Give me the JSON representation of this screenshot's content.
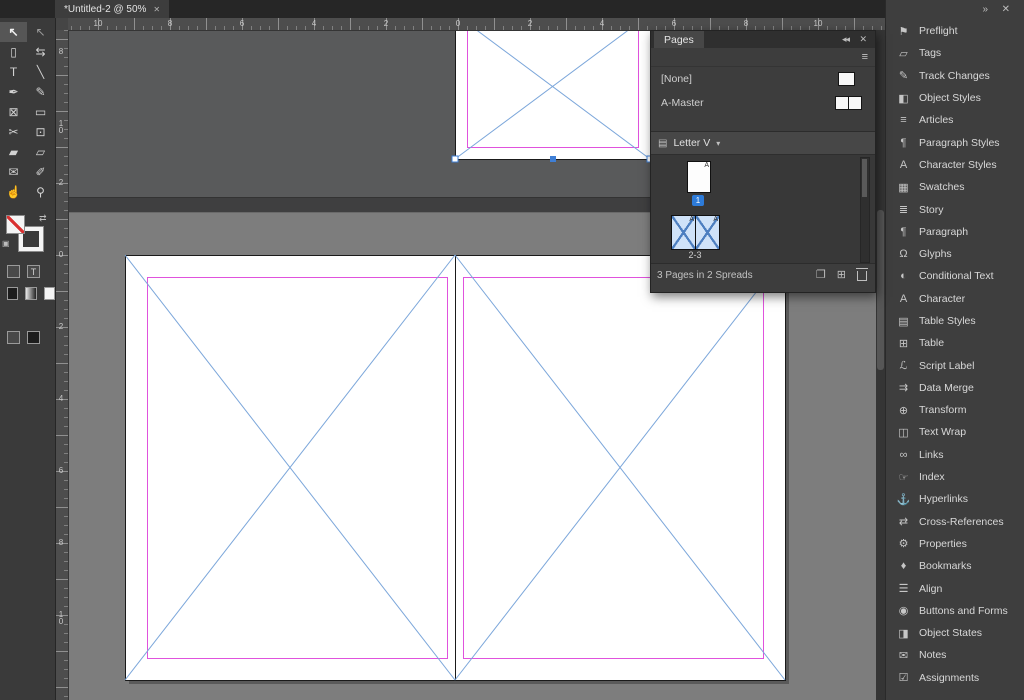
{
  "window": {
    "tab_title": "*Untitled-2 @ 50%",
    "tab_close_icon": "✕"
  },
  "toolbar": {
    "tools": [
      {
        "name": "selection-tool",
        "glyph": "↖",
        "style": "filled",
        "active": true
      },
      {
        "name": "direct-selection-tool",
        "glyph": "↖",
        "style": "hollow"
      },
      {
        "name": "page-tool",
        "glyph": "▯"
      },
      {
        "name": "gap-tool",
        "glyph": "⇆"
      },
      {
        "name": "type-tool",
        "glyph": "T"
      },
      {
        "name": "line-tool",
        "glyph": "╲"
      },
      {
        "name": "pen-tool",
        "glyph": "✒"
      },
      {
        "name": "pencil-tool",
        "glyph": "✎"
      },
      {
        "name": "rectangle-frame-tool",
        "glyph": "⊠"
      },
      {
        "name": "rectangle-tool",
        "glyph": "▭"
      },
      {
        "name": "scissors-tool",
        "glyph": "✂"
      },
      {
        "name": "free-transform-tool",
        "glyph": "⊡"
      },
      {
        "name": "gradient-swatch-tool",
        "glyph": "▰"
      },
      {
        "name": "gradient-feather-tool",
        "glyph": "▱"
      },
      {
        "name": "note-tool",
        "glyph": "✉"
      },
      {
        "name": "eyedropper-tool",
        "glyph": "✐"
      },
      {
        "name": "hand-tool",
        "glyph": "☝"
      },
      {
        "name": "zoom-tool",
        "glyph": "⚲"
      }
    ],
    "apply_buttons_letter": "T"
  },
  "rulers": {
    "horizontal": [
      "10",
      "8",
      "6",
      "4",
      "2",
      "0",
      "2",
      "4",
      "6",
      "8",
      "10"
    ],
    "vertical": [
      "8",
      "10",
      "2",
      "0",
      "2",
      "4",
      "6",
      "8",
      "10"
    ]
  },
  "pages_panel": {
    "title": "Pages",
    "collapse_icon": "◂◂",
    "close_icon": "✕",
    "menu_icon": "≡",
    "masters": [
      {
        "label": "[None]"
      },
      {
        "label": "A-Master"
      }
    ],
    "size_preset": {
      "icon": "▤",
      "label": "Letter V",
      "caret": "▾"
    },
    "pages": [
      {
        "badge": "1",
        "master_letter": "A"
      },
      {
        "label": "2-3",
        "master_letter": "A"
      }
    ],
    "status": "3 Pages in 2 Spreads",
    "status_icons": {
      "edit_spread": "❐",
      "new_page": "⊞"
    }
  },
  "dock": {
    "collapse_icon": "»",
    "close_icon": "✕",
    "panels": [
      {
        "icon": "⚑",
        "label": "Preflight"
      },
      {
        "icon": "▱",
        "label": "Tags"
      },
      {
        "icon": "✎",
        "label": "Track Changes"
      },
      {
        "icon": "◧",
        "label": "Object Styles"
      },
      {
        "icon": "≡",
        "label": "Articles"
      },
      {
        "icon": "¶",
        "label": "Paragraph Styles"
      },
      {
        "icon": "A",
        "label": "Character Styles"
      },
      {
        "icon": "▦",
        "label": "Swatches"
      },
      {
        "icon": "≣",
        "label": "Story"
      },
      {
        "icon": "¶",
        "label": "Paragraph"
      },
      {
        "icon": "Ω",
        "label": "Glyphs"
      },
      {
        "icon": "◐",
        "label": "Conditional Text"
      },
      {
        "icon": "A",
        "label": "Character"
      },
      {
        "icon": "▤",
        "label": "Table Styles"
      },
      {
        "icon": "⊞",
        "label": "Table"
      },
      {
        "icon": "ℒ",
        "label": "Script Label"
      },
      {
        "icon": "⇉",
        "label": "Data Merge"
      },
      {
        "icon": "⊕",
        "label": "Transform"
      },
      {
        "icon": "◫",
        "label": "Text Wrap"
      },
      {
        "icon": "∞",
        "label": "Links"
      },
      {
        "icon": "☞",
        "label": "Index"
      },
      {
        "icon": "⚓",
        "label": "Hyperlinks"
      },
      {
        "icon": "⇄",
        "label": "Cross-References"
      },
      {
        "icon": "⚙",
        "label": "Properties"
      },
      {
        "icon": "♦",
        "label": "Bookmarks"
      },
      {
        "icon": "☰",
        "label": "Align"
      },
      {
        "icon": "◉",
        "label": "Buttons and Forms"
      },
      {
        "icon": "◨",
        "label": "Object States"
      },
      {
        "icon": "✉",
        "label": "Notes"
      },
      {
        "icon": "☑",
        "label": "Assignments"
      }
    ]
  },
  "colors": {
    "accent_blue": "#2d7bd9",
    "margin_guide_magenta": "#e052dd",
    "frame_guide_blue": "#7ba6da",
    "pasteboard_gray": "#7d7d7d",
    "panel_gray": "#3d3d3d"
  }
}
